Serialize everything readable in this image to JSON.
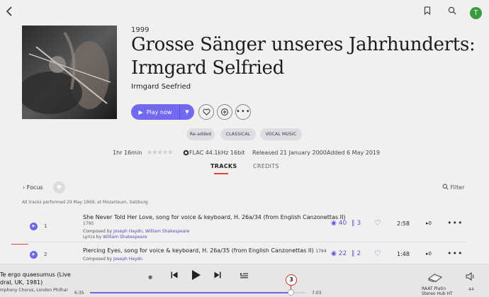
{
  "album": {
    "year": "1999",
    "title": "Grosse Sänger unseres Jahrhunderts: Irmgard Selfried",
    "artist": "Irmgard Seefried",
    "play_label": "Play now",
    "tags": [
      "Re-added",
      "CLASSICAL",
      "VOCAL MUSIC"
    ],
    "duration": "1hr 16min",
    "rating_stars": "☆☆☆☆☆",
    "format": "FLAC 44.1kHz 16bit",
    "released": "Released 21 January 2000",
    "added": "Added 6 May 2019"
  },
  "tabs": {
    "tracks": "TRACKS",
    "credits": "CREDITS"
  },
  "focus": {
    "label": "Focus",
    "filter": "Filter"
  },
  "performed_note": "All tracks performed 29 May 1969, at Mozarteum, Salzburg.",
  "tracks": [
    {
      "num": "1",
      "title": "She Never Told Her Love, song for voice & keyboard, H. 26a/34 (from English Canzonettas II)",
      "year": "1795",
      "composed_prefix": "Composed by ",
      "composed": "Joseph Haydn, William Shakespeare",
      "lyrics_prefix": "Lyrics by ",
      "lyrics": "William Shakespeare",
      "versions": "40",
      "copies": "3",
      "duration": "2:58",
      "plays": "0"
    },
    {
      "num": "2",
      "title": "Piercing Eyes, song for voice & keyboard, H. 26a/35 (from English Canzonettas II)",
      "year": "1794",
      "composed_prefix": "Composed by ",
      "composed": "Joseph Haydn",
      "versions": "22",
      "copies": "2",
      "duration": "1:48",
      "plays": "0"
    }
  ],
  "player": {
    "title_line1": "Te ergo quaesumus (Live",
    "title_line2": "dral, UK, 1981)",
    "subtitle": "mphony Chorus, London Philhar",
    "time_current": "6:35",
    "time_total": "7:03",
    "progress": 0.93,
    "badge": "3",
    "zone_line1": "RAAT Platin",
    "zone_line2": "Stereo Hub HT",
    "volume": "44"
  },
  "colors": {
    "accent": "#7169f0",
    "red": "#e0413b",
    "avatar": "#3a9a3f"
  },
  "icons": {
    "back": "chevron-left-icon",
    "bookmark": "bookmark-icon",
    "search": "search-icon",
    "heart": "heart-icon",
    "add": "add-to-queue-icon",
    "more": "more-icon",
    "play": "play-icon",
    "prev": "previous-icon",
    "next": "next-icon",
    "queue": "queue-icon",
    "zone": "zone-device-icon",
    "volume": "volume-icon"
  },
  "user": {
    "initial": "T"
  }
}
